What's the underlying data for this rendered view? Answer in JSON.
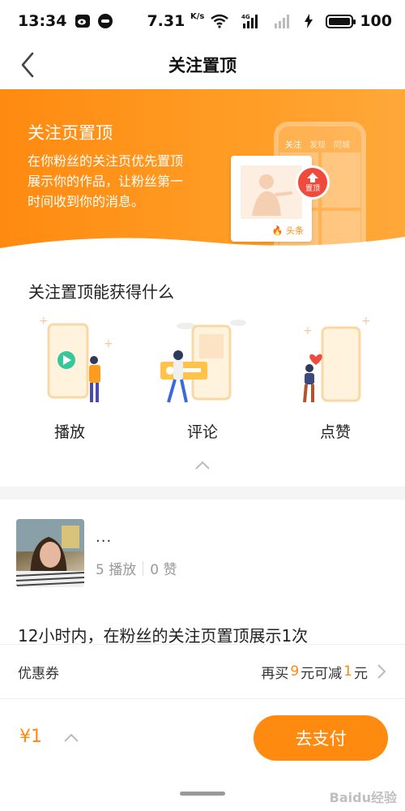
{
  "status_bar": {
    "time": "13:34",
    "net_speed": "7.31",
    "net_unit": "K/s",
    "network": "4G",
    "battery": "100"
  },
  "nav": {
    "title": "关注置顶",
    "back_icon": "chevron-left-icon"
  },
  "banner": {
    "title": "关注页置顶",
    "description": "在你粉丝的关注页优先置顶展示你的作品，让粉丝第一时间收到你的消息。",
    "phone_tabs": [
      "关注",
      "发现",
      "同城"
    ],
    "badge_label": "置顶",
    "card_tag": "头条"
  },
  "benefits": {
    "heading": "关注置顶能获得什么",
    "items": [
      {
        "label": "播放",
        "icon": "play-illustration"
      },
      {
        "label": "评论",
        "icon": "comment-illustration"
      },
      {
        "label": "点赞",
        "icon": "like-illustration"
      }
    ]
  },
  "video": {
    "name": "...",
    "plays": "5 播放",
    "likes": "0 赞"
  },
  "description": "12小时内，在粉丝的关注页置顶展示1次",
  "coupon": {
    "label": "优惠券",
    "prefix": "再买",
    "amount1": "9",
    "middle": "元可减",
    "amount2": "1",
    "suffix": "元"
  },
  "paybar": {
    "price": "¥1",
    "pay_label": "去支付"
  },
  "watermark": "Baidu经验",
  "colors": {
    "accent": "#ff8a10",
    "badge": "#f04a3c"
  }
}
